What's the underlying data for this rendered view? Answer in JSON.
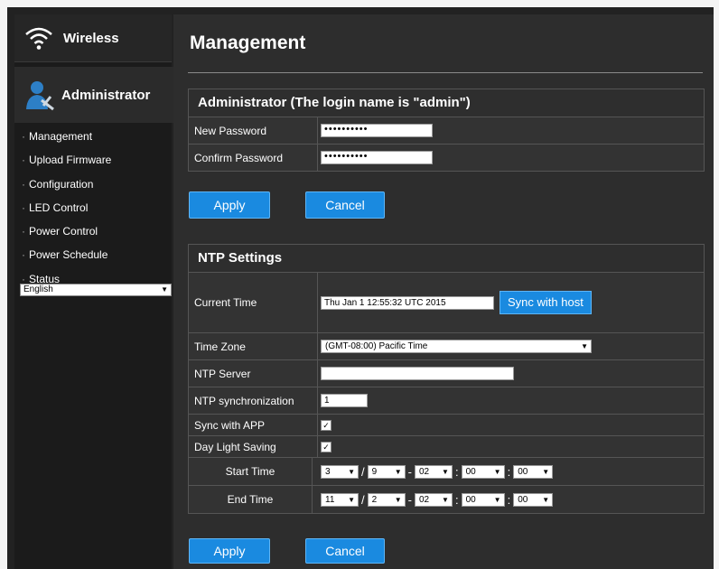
{
  "sidebar": {
    "wireless_label": "Wireless",
    "admin_label": "Administrator",
    "items": [
      "Management",
      "Upload Firmware",
      "Configuration",
      "LED Control",
      "Power Control",
      "Power Schedule",
      "Status"
    ],
    "language": "English"
  },
  "page": {
    "title": "Management"
  },
  "admin": {
    "header": "Administrator (The login name is \"admin\")",
    "new_password_label": "New Password",
    "new_password_value": "••••••••••",
    "confirm_password_label": "Confirm Password",
    "confirm_password_value": "••••••••••",
    "apply_label": "Apply",
    "cancel_label": "Cancel"
  },
  "ntp": {
    "header": "NTP Settings",
    "current_time_label": "Current Time",
    "current_time_value": "Thu Jan  1 12:55:32 UTC 2015",
    "sync_host_label": "Sync with host",
    "time_zone_label": "Time Zone",
    "time_zone_value": "(GMT-08:00) Pacific Time",
    "ntp_server_label": "NTP Server",
    "ntp_server_value": "",
    "ntp_sync_label": "NTP synchronization",
    "ntp_sync_value": "1",
    "sync_app_label": "Sync with APP",
    "sync_app_checked": true,
    "dst_label": "Day Light Saving",
    "dst_checked": true,
    "start_time_label": "Start Time",
    "start": {
      "month": "3",
      "week": "9",
      "day": "02",
      "hour": "00",
      "min": "00"
    },
    "end_time_label": "End Time",
    "end": {
      "month": "11",
      "week": "2",
      "day": "02",
      "hour": "00",
      "min": "00"
    },
    "apply_label": "Apply",
    "cancel_label": "Cancel"
  },
  "colors": {
    "accent": "#1a8ae0",
    "panel": "#333333",
    "sidebar": "#1b1b1b"
  }
}
